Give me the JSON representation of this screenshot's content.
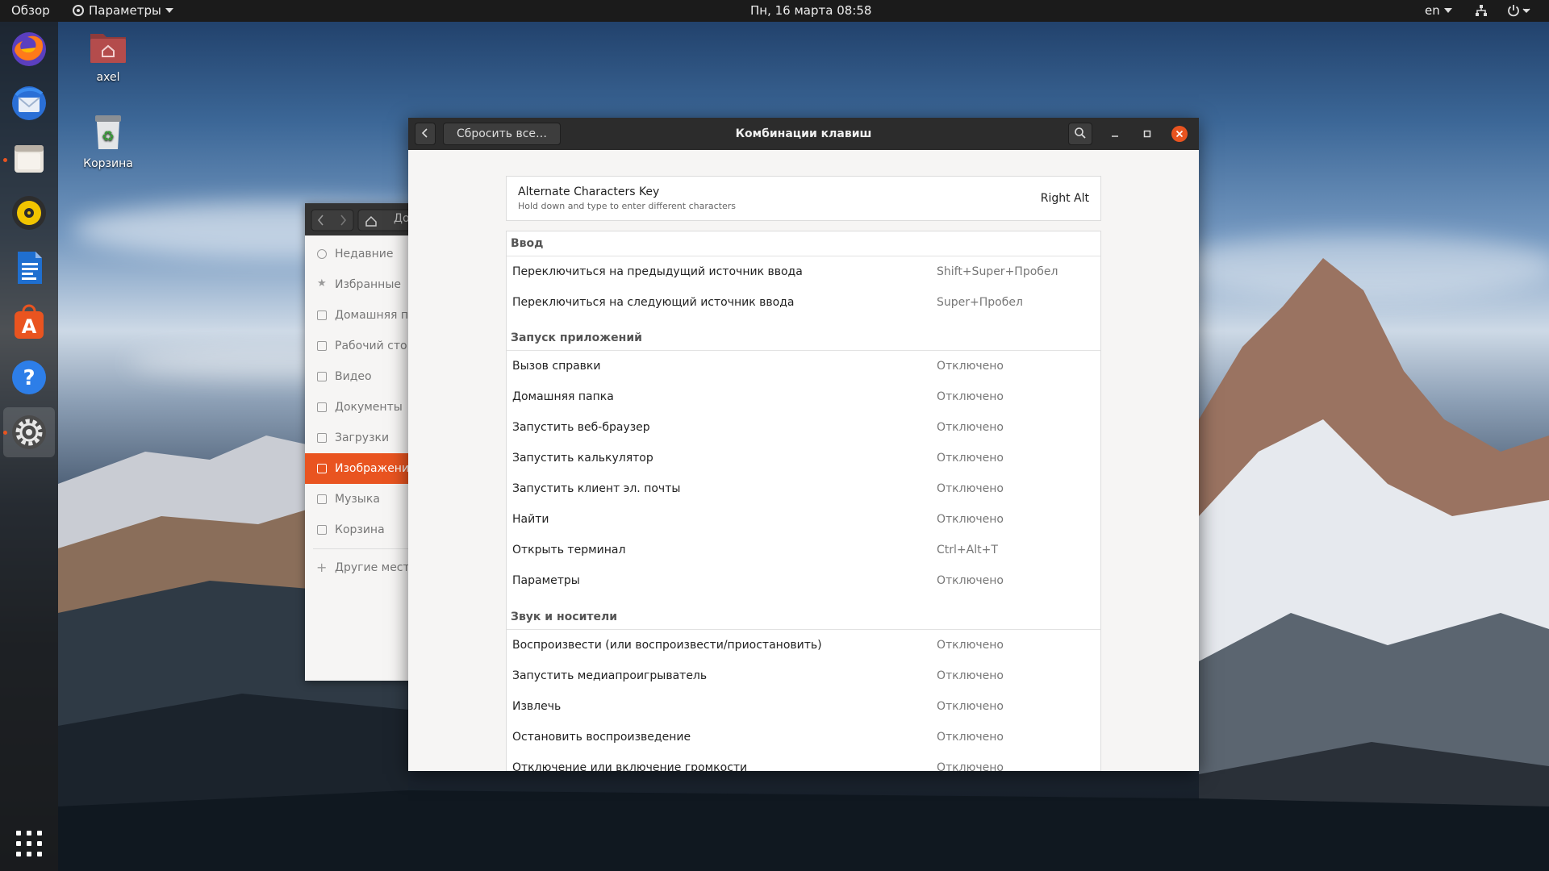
{
  "topbar": {
    "activities": "Обзор",
    "app_menu": "Параметры",
    "clock": "Пн, 16 марта  08:58",
    "lang": "en"
  },
  "icons": {
    "dock": [
      "firefox-icon",
      "thunderbird-icon",
      "files-icon",
      "rhythmbox-icon",
      "writer-icon",
      "software-icon",
      "help-icon",
      "settings-icon",
      "app-grid-icon"
    ],
    "top": [
      "settings-gear-icon",
      "network-icon",
      "power-icon"
    ]
  },
  "desktop": {
    "home_label": "axel",
    "trash_label": "Корзина"
  },
  "files_window": {
    "path_fragment": "До",
    "items": [
      "Недавние",
      "Избранные",
      "Домашняя па",
      "Рабочий сто",
      "Видео",
      "Документы",
      "Загрузки",
      "Изображени",
      "Музыка",
      "Корзина"
    ],
    "other": "Другие места"
  },
  "window": {
    "title": "Комбинации клавиш",
    "reset_label": "Сбросить все…",
    "alternate": {
      "title": "Alternate Characters Key",
      "subtitle": "Hold down and type to enter different characters",
      "value": "Right Alt"
    },
    "sections": [
      {
        "title": "Ввод",
        "rows": [
          {
            "name": "Переключиться на предыдущий источник ввода",
            "key": "Shift+Super+Пробел"
          },
          {
            "name": "Переключиться на следующий источник ввода",
            "key": "Super+Пробел"
          }
        ]
      },
      {
        "title": "Запуск приложений",
        "rows": [
          {
            "name": "Вызов справки",
            "key": "Отключено"
          },
          {
            "name": "Домашняя папка",
            "key": "Отключено"
          },
          {
            "name": "Запустить веб-браузер",
            "key": "Отключено"
          },
          {
            "name": "Запустить калькулятор",
            "key": "Отключено"
          },
          {
            "name": "Запустить клиент эл. почты",
            "key": "Отключено"
          },
          {
            "name": "Найти",
            "key": "Отключено"
          },
          {
            "name": "Открыть терминал",
            "key": "Ctrl+Alt+T"
          },
          {
            "name": "Параметры",
            "key": "Отключено"
          }
        ]
      },
      {
        "title": "Звук и носители",
        "rows": [
          {
            "name": "Воспроизвести (или воспроизвести/приостановить)",
            "key": "Отключено"
          },
          {
            "name": "Запустить медиапроигрыватель",
            "key": "Отключено"
          },
          {
            "name": "Извлечь",
            "key": "Отключено"
          },
          {
            "name": "Остановить воспроизведение",
            "key": "Отключено"
          },
          {
            "name": "Отключение или включение громкости",
            "key": "Отключено"
          }
        ]
      }
    ]
  },
  "colors": {
    "accent": "#e95420",
    "header": "#2c2c2c",
    "topbar": "#1b1b1b"
  }
}
